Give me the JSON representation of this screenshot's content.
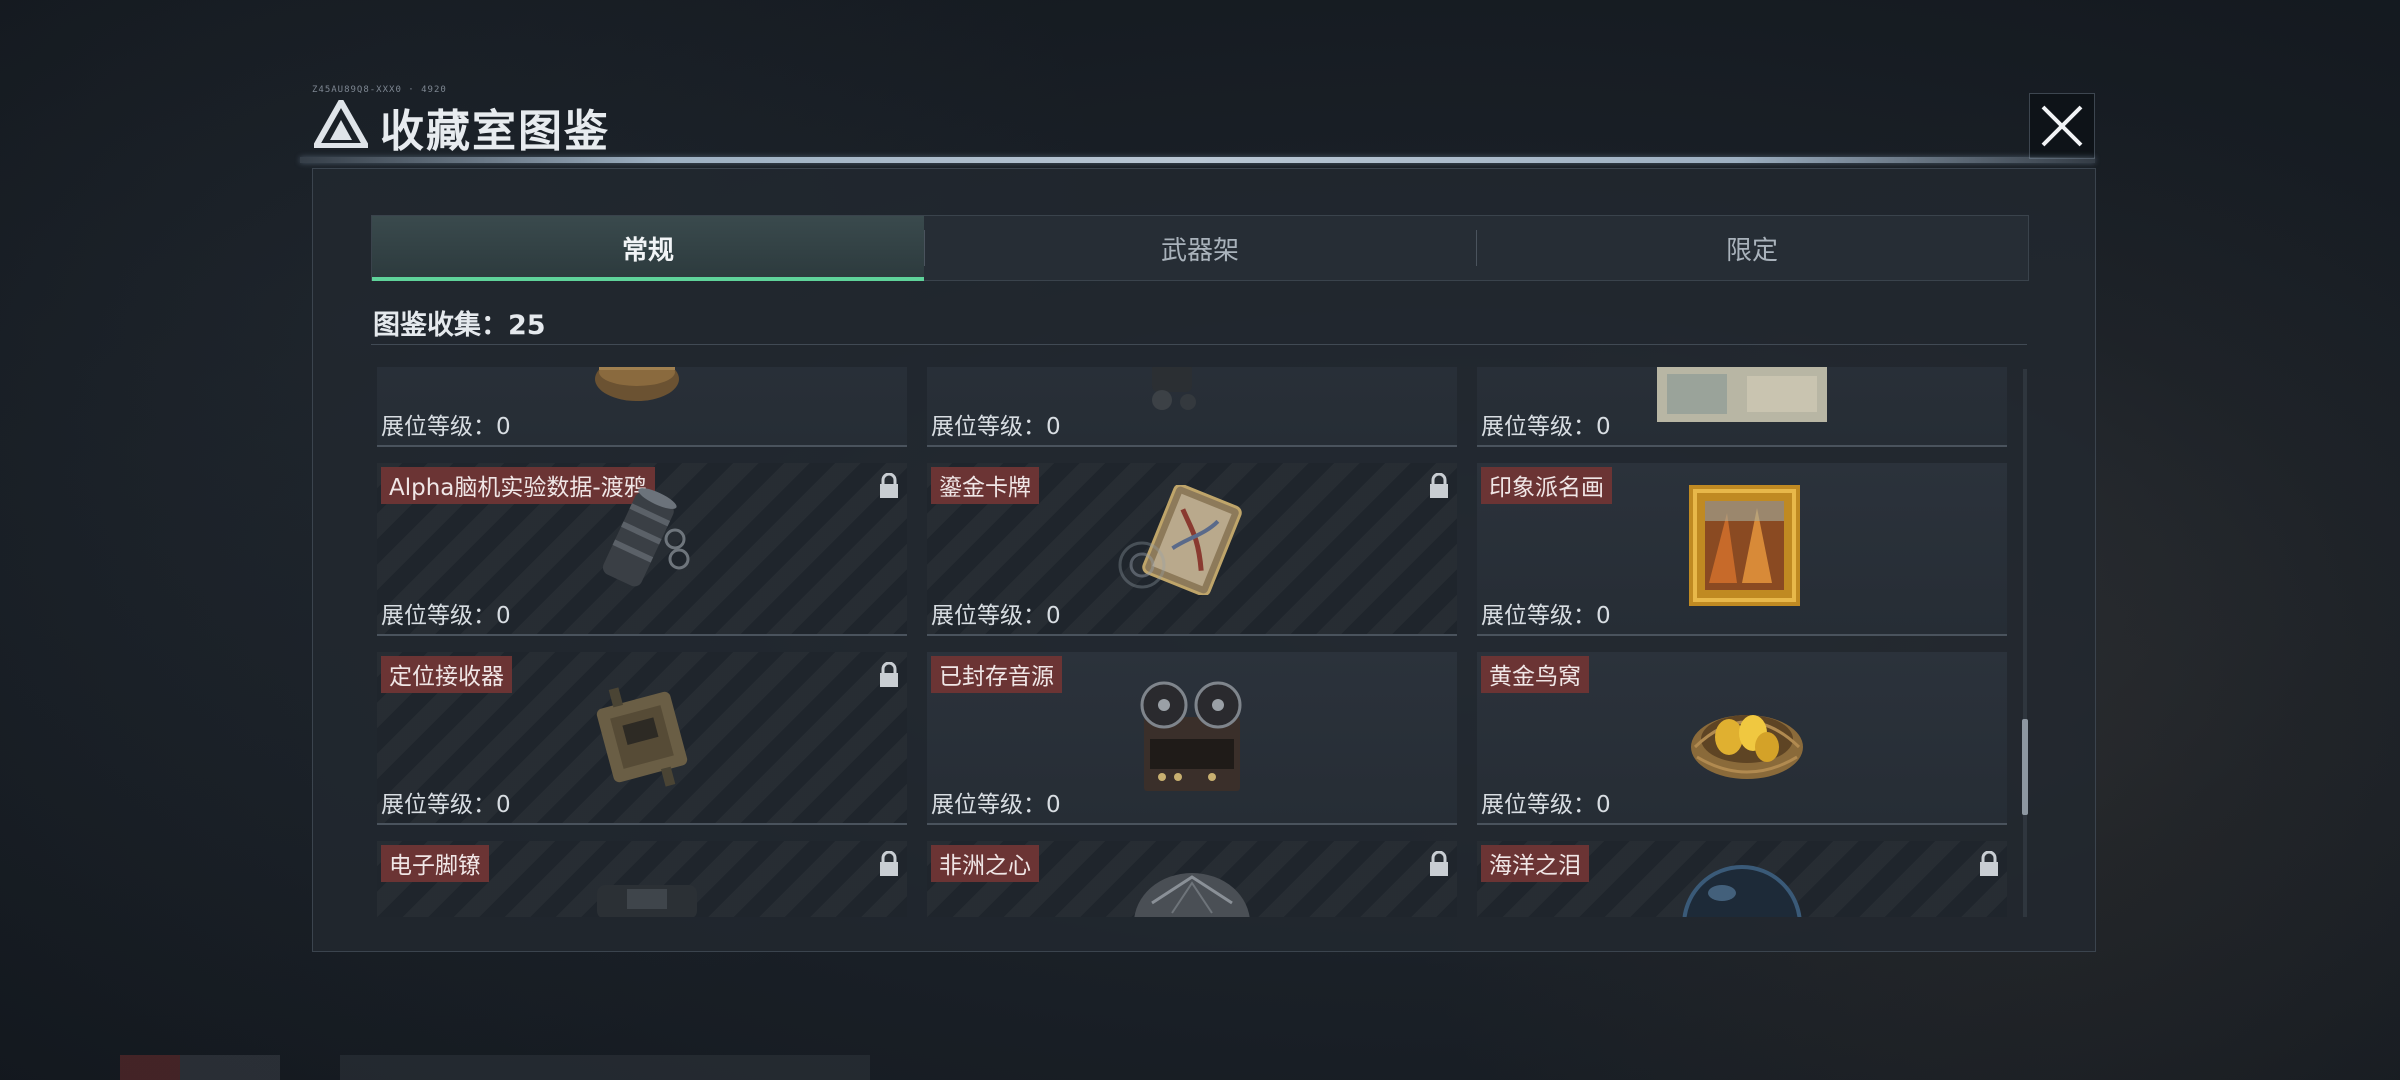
{
  "header": {
    "title": "收藏室图鉴",
    "tag": "Z45AU89Q8-XXX0 · 4920"
  },
  "tabs": [
    {
      "label": "常规",
      "active": true
    },
    {
      "label": "武器架",
      "active": false
    },
    {
      "label": "限定",
      "active": false
    }
  ],
  "collection": {
    "label": "图鉴收集：25"
  },
  "level_label": "展位等级：0",
  "items": [
    {
      "name": "",
      "locked": false,
      "icon": "brass-vessel"
    },
    {
      "name": "",
      "locked": false,
      "icon": "dark-device"
    },
    {
      "name": "",
      "locked": false,
      "icon": "old-painting"
    },
    {
      "name": "Alpha脑机实验数据-渡鸦",
      "locked": true,
      "icon": "data-canister"
    },
    {
      "name": "鎏金卡牌",
      "locked": true,
      "icon": "gilded-card"
    },
    {
      "name": "印象派名画",
      "locked": false,
      "icon": "framed-painting"
    },
    {
      "name": "定位接收器",
      "locked": true,
      "icon": "locator-receiver"
    },
    {
      "name": "已封存音源",
      "locked": false,
      "icon": "reel-to-reel-recorder"
    },
    {
      "name": "黄金鸟窝",
      "locked": false,
      "icon": "golden-nest"
    },
    {
      "name": "电子脚镣",
      "locked": true,
      "icon": "electronic-anklet"
    },
    {
      "name": "非洲之心",
      "locked": true,
      "icon": "diamond"
    },
    {
      "name": "海洋之泪",
      "locked": true,
      "icon": "ocean-pearl"
    }
  ],
  "colors": {
    "accent": "#5fd39a",
    "label_bg": "#6b3434"
  }
}
